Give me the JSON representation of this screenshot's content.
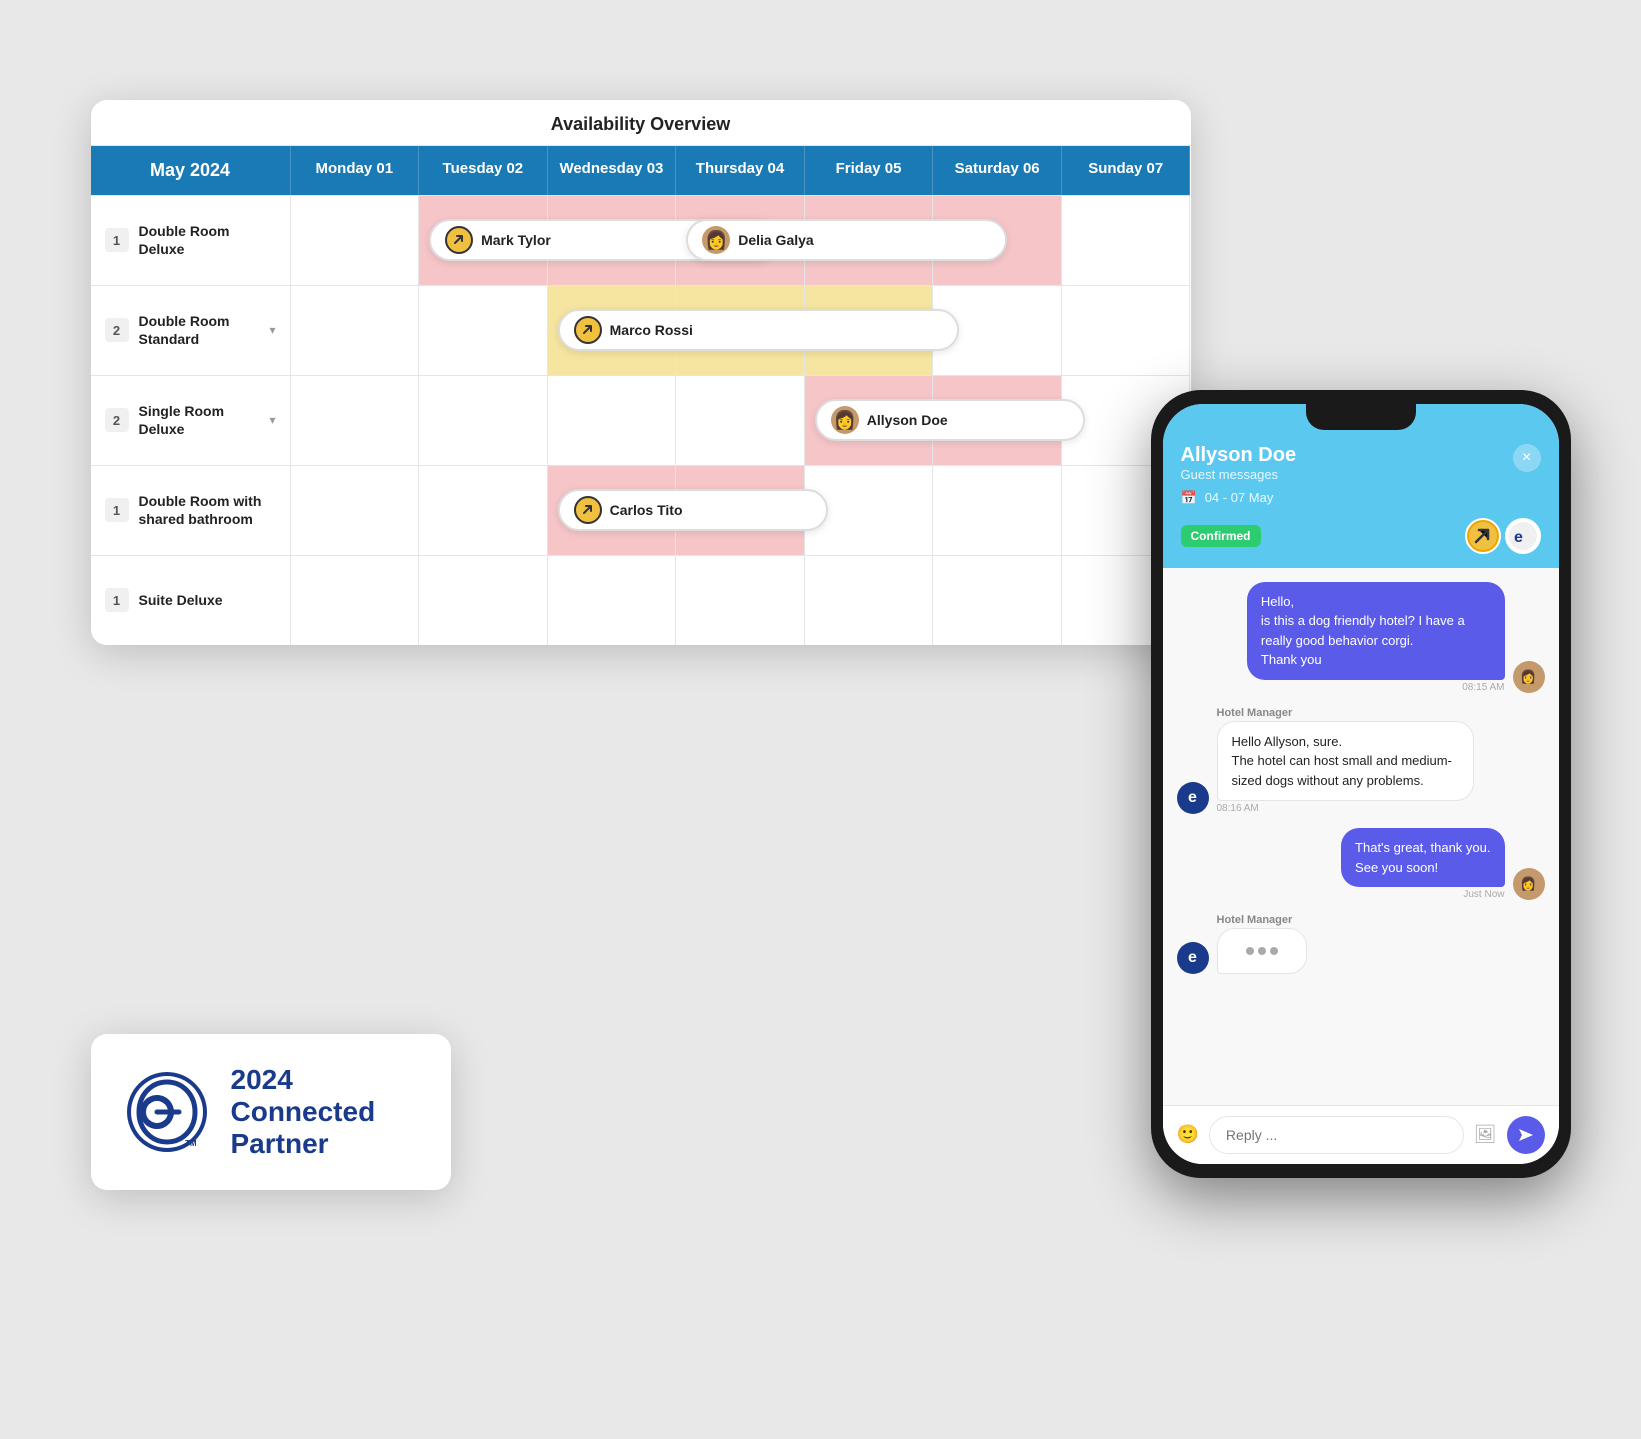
{
  "calendar": {
    "title": "Availability Overview",
    "header": {
      "month": "May 2024",
      "days": [
        "Monday 01",
        "Tuesday 02",
        "Wednesday 03",
        "Thursday 04",
        "Friday 05",
        "Saturday 06",
        "Sunday 07"
      ]
    },
    "rooms": [
      {
        "num": "1",
        "name": "Double Room Deluxe",
        "expand": false
      },
      {
        "num": "2",
        "name": "Double Room Standard",
        "expand": true
      },
      {
        "num": "2",
        "name": "Single Room Deluxe",
        "expand": true
      },
      {
        "num": "1",
        "name": "Double Room with shared bathroom",
        "expand": false
      },
      {
        "num": "1",
        "name": "Suite Deluxe",
        "expand": false
      }
    ],
    "bookings": [
      {
        "guest": "Mark Tylor",
        "type": "arrow",
        "row": 0,
        "startDay": 1,
        "span": 2.5
      },
      {
        "guest": "Delia Galya",
        "type": "photo",
        "row": 0,
        "startDay": 3,
        "span": 2.5
      },
      {
        "guest": "Marco Rossi",
        "type": "arrow",
        "row": 1,
        "startDay": 2,
        "span": 3
      },
      {
        "guest": "Allyson Doe",
        "type": "photo",
        "row": 2,
        "startDay": 4,
        "span": 2
      },
      {
        "guest": "Carlos Tito",
        "type": "arrow",
        "row": 3,
        "startDay": 2,
        "span": 2
      }
    ]
  },
  "partner": {
    "year": "2024",
    "title": "Connected",
    "subtitle": "Partner"
  },
  "chat": {
    "guest_name": "Allyson Doe",
    "subtitle": "Guest messages",
    "date": "04 - 07 May",
    "status": "Confirmed",
    "close_label": "×",
    "messages": [
      {
        "sender": "guest",
        "text": "Hello,\nis this a dog friendly hotel? I have a really good behavior corgi.\nThank you",
        "time": "08:15 AM"
      },
      {
        "sender": "hotel",
        "sender_label": "Hotel Manager",
        "text": "Hello Allyson, sure.\nThe hotel can host small and medium-sized dogs without any problems.",
        "time": "08:16 AM"
      },
      {
        "sender": "guest",
        "text": "That's great, thank you.\nSee you soon!",
        "time": "Just Now"
      },
      {
        "sender": "hotel",
        "sender_label": "Hotel Manager",
        "typing": true
      }
    ],
    "input_placeholder": "Reply ..."
  }
}
